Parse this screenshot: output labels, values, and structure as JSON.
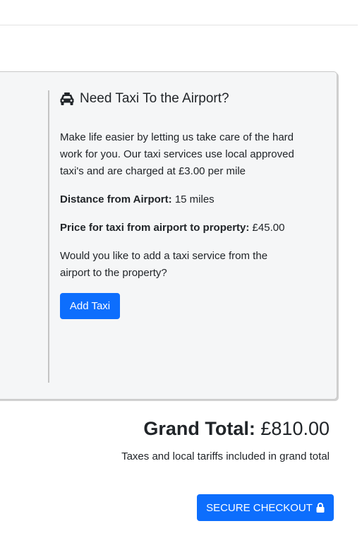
{
  "taxi": {
    "title": "Need Taxi To the Airport?",
    "intro": "Make life easier by letting us take care of the hard work for you. Our taxi services use local approved taxi's and are charged at £3.00 per mile",
    "distance_label": "Distance from Airport:",
    "distance_value": "15 miles",
    "price_label": "Price for taxi from airport to property:",
    "price_value": "£45.00",
    "question": "Would you like to add a taxi service from the airport to the property?",
    "add_button": "Add Taxi"
  },
  "summary": {
    "grand_total_label": "Grand Total:",
    "grand_total_value": "£810.00",
    "tax_note": "Taxes and local tariffs included in grand total"
  },
  "checkout": {
    "label": "SECURE CHECKOUT",
    "icon": "lock-icon"
  },
  "colors": {
    "primary": "#0d6efd",
    "card_bg": "#f5f6f7"
  }
}
